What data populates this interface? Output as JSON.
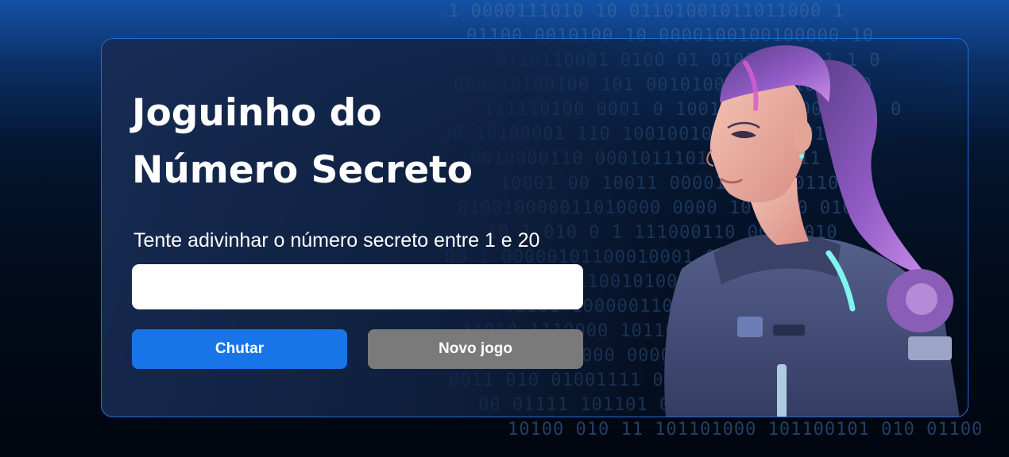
{
  "game": {
    "title_line1": "Joguinho do",
    "title_line2": "Número Secreto",
    "instruction": "Tente adivinhar o número secreto entre 1 e 20",
    "input_value": "",
    "guess_button": "Chutar",
    "new_game_button": "Novo jogo"
  },
  "background": {
    "binary_lines": [
      "11 0000111010  10 01101001011011000 1",
      "01100 0010100 10 0000100100100000 10",
      "0110110001 0100 01 01010111011 1 0",
      "000110100100 101 00101000 10101000010",
      "111110100 0001 0 1001010 10000011 1 0",
      "00 10100001 110 10010010 0 1 001011",
      "0010000110 0001011101 0 10 0011",
      "10001 00 10011 00001111 000110 01",
      "010010000011010000 0000 10 10 0 01000",
      "10 1 010 0 1 111000110 00011010",
      "00 1 00000101100010001 010000 01000",
      "1001 0000110010100001100 00110",
      "01101 1000001100001001 110001 0",
      "11010 1110000 10110100001 1 110 0",
      "00000 00000 000000 1 1 110 1 0",
      "0011 010 01001111 0011 1",
      "00 01111 101101 0001001 0",
      "10100 010 11 101101000 101100101 010 01100"
    ]
  },
  "colors": {
    "accent_button": "#1875e8",
    "secondary_button": "#7a7a7a",
    "card_border": "#1f6fd8",
    "background_top": "#1552a6",
    "background_bottom": "#01060f"
  }
}
